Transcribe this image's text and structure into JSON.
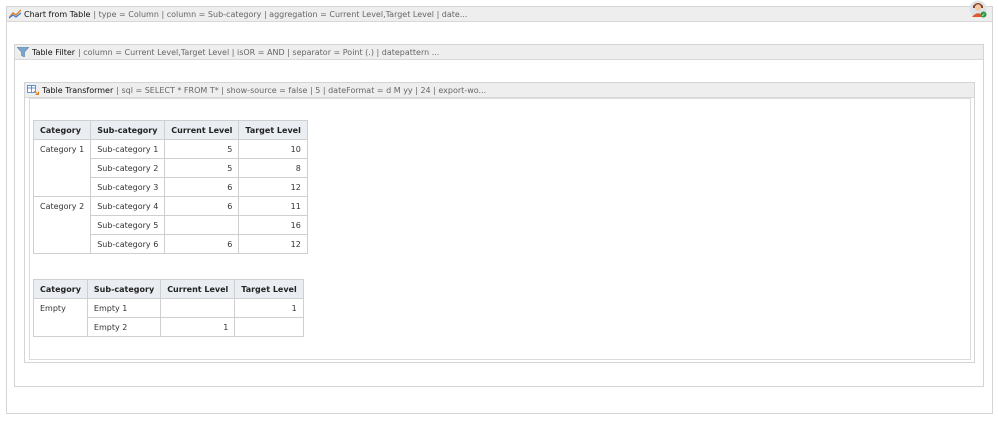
{
  "chart_macro": {
    "name": "Chart from Table",
    "params": "| type = Column | column = Sub-category | aggregation = Current Level,Target Level | date..."
  },
  "filter_macro": {
    "name": "Table Filter",
    "params": "| column = Current Level,Target Level | isOR = AND | separator = Point (.) | datepattern ..."
  },
  "transformer_macro": {
    "name": "Table Transformer",
    "params": "| sql = SELECT * FROM T* | show-source = false | 5 | dateFormat = d M yy | 24 | export-wo..."
  },
  "table_one": {
    "headers": [
      "Category",
      "Sub-category",
      "Current Level",
      "Target Level"
    ],
    "groups": [
      {
        "category": "Category 1",
        "rows": [
          {
            "sub": "Sub-category 1",
            "current": "5",
            "target": "10"
          },
          {
            "sub": "Sub-category 2",
            "current": "5",
            "target": "8"
          },
          {
            "sub": "Sub-category 3",
            "current": "6",
            "target": "12"
          }
        ]
      },
      {
        "category": "Category 2",
        "rows": [
          {
            "sub": "Sub-category 4",
            "current": "6",
            "target": "11"
          },
          {
            "sub": "Sub-category 5",
            "current": "",
            "target": "16"
          },
          {
            "sub": "Sub-category 6",
            "current": "6",
            "target": "12"
          }
        ]
      }
    ]
  },
  "table_two": {
    "headers": [
      "Category",
      "Sub-category",
      "Current Level",
      "Target Level"
    ],
    "groups": [
      {
        "category": "Empty",
        "rows": [
          {
            "sub": "Empty 1",
            "current": "",
            "target": "1"
          },
          {
            "sub": "Empty 2",
            "current": "1",
            "target": ""
          }
        ]
      }
    ]
  },
  "icons": {
    "chart": "line-chart-icon",
    "filter": "funnel-filter-icon",
    "transformer": "table-transform-icon",
    "avatar": "user-avatar-icon"
  },
  "colors": {
    "header_bg": "#eaeef3",
    "title_bar_bg": "#eeeeee",
    "avatar_badge": "#2e9a3e"
  }
}
